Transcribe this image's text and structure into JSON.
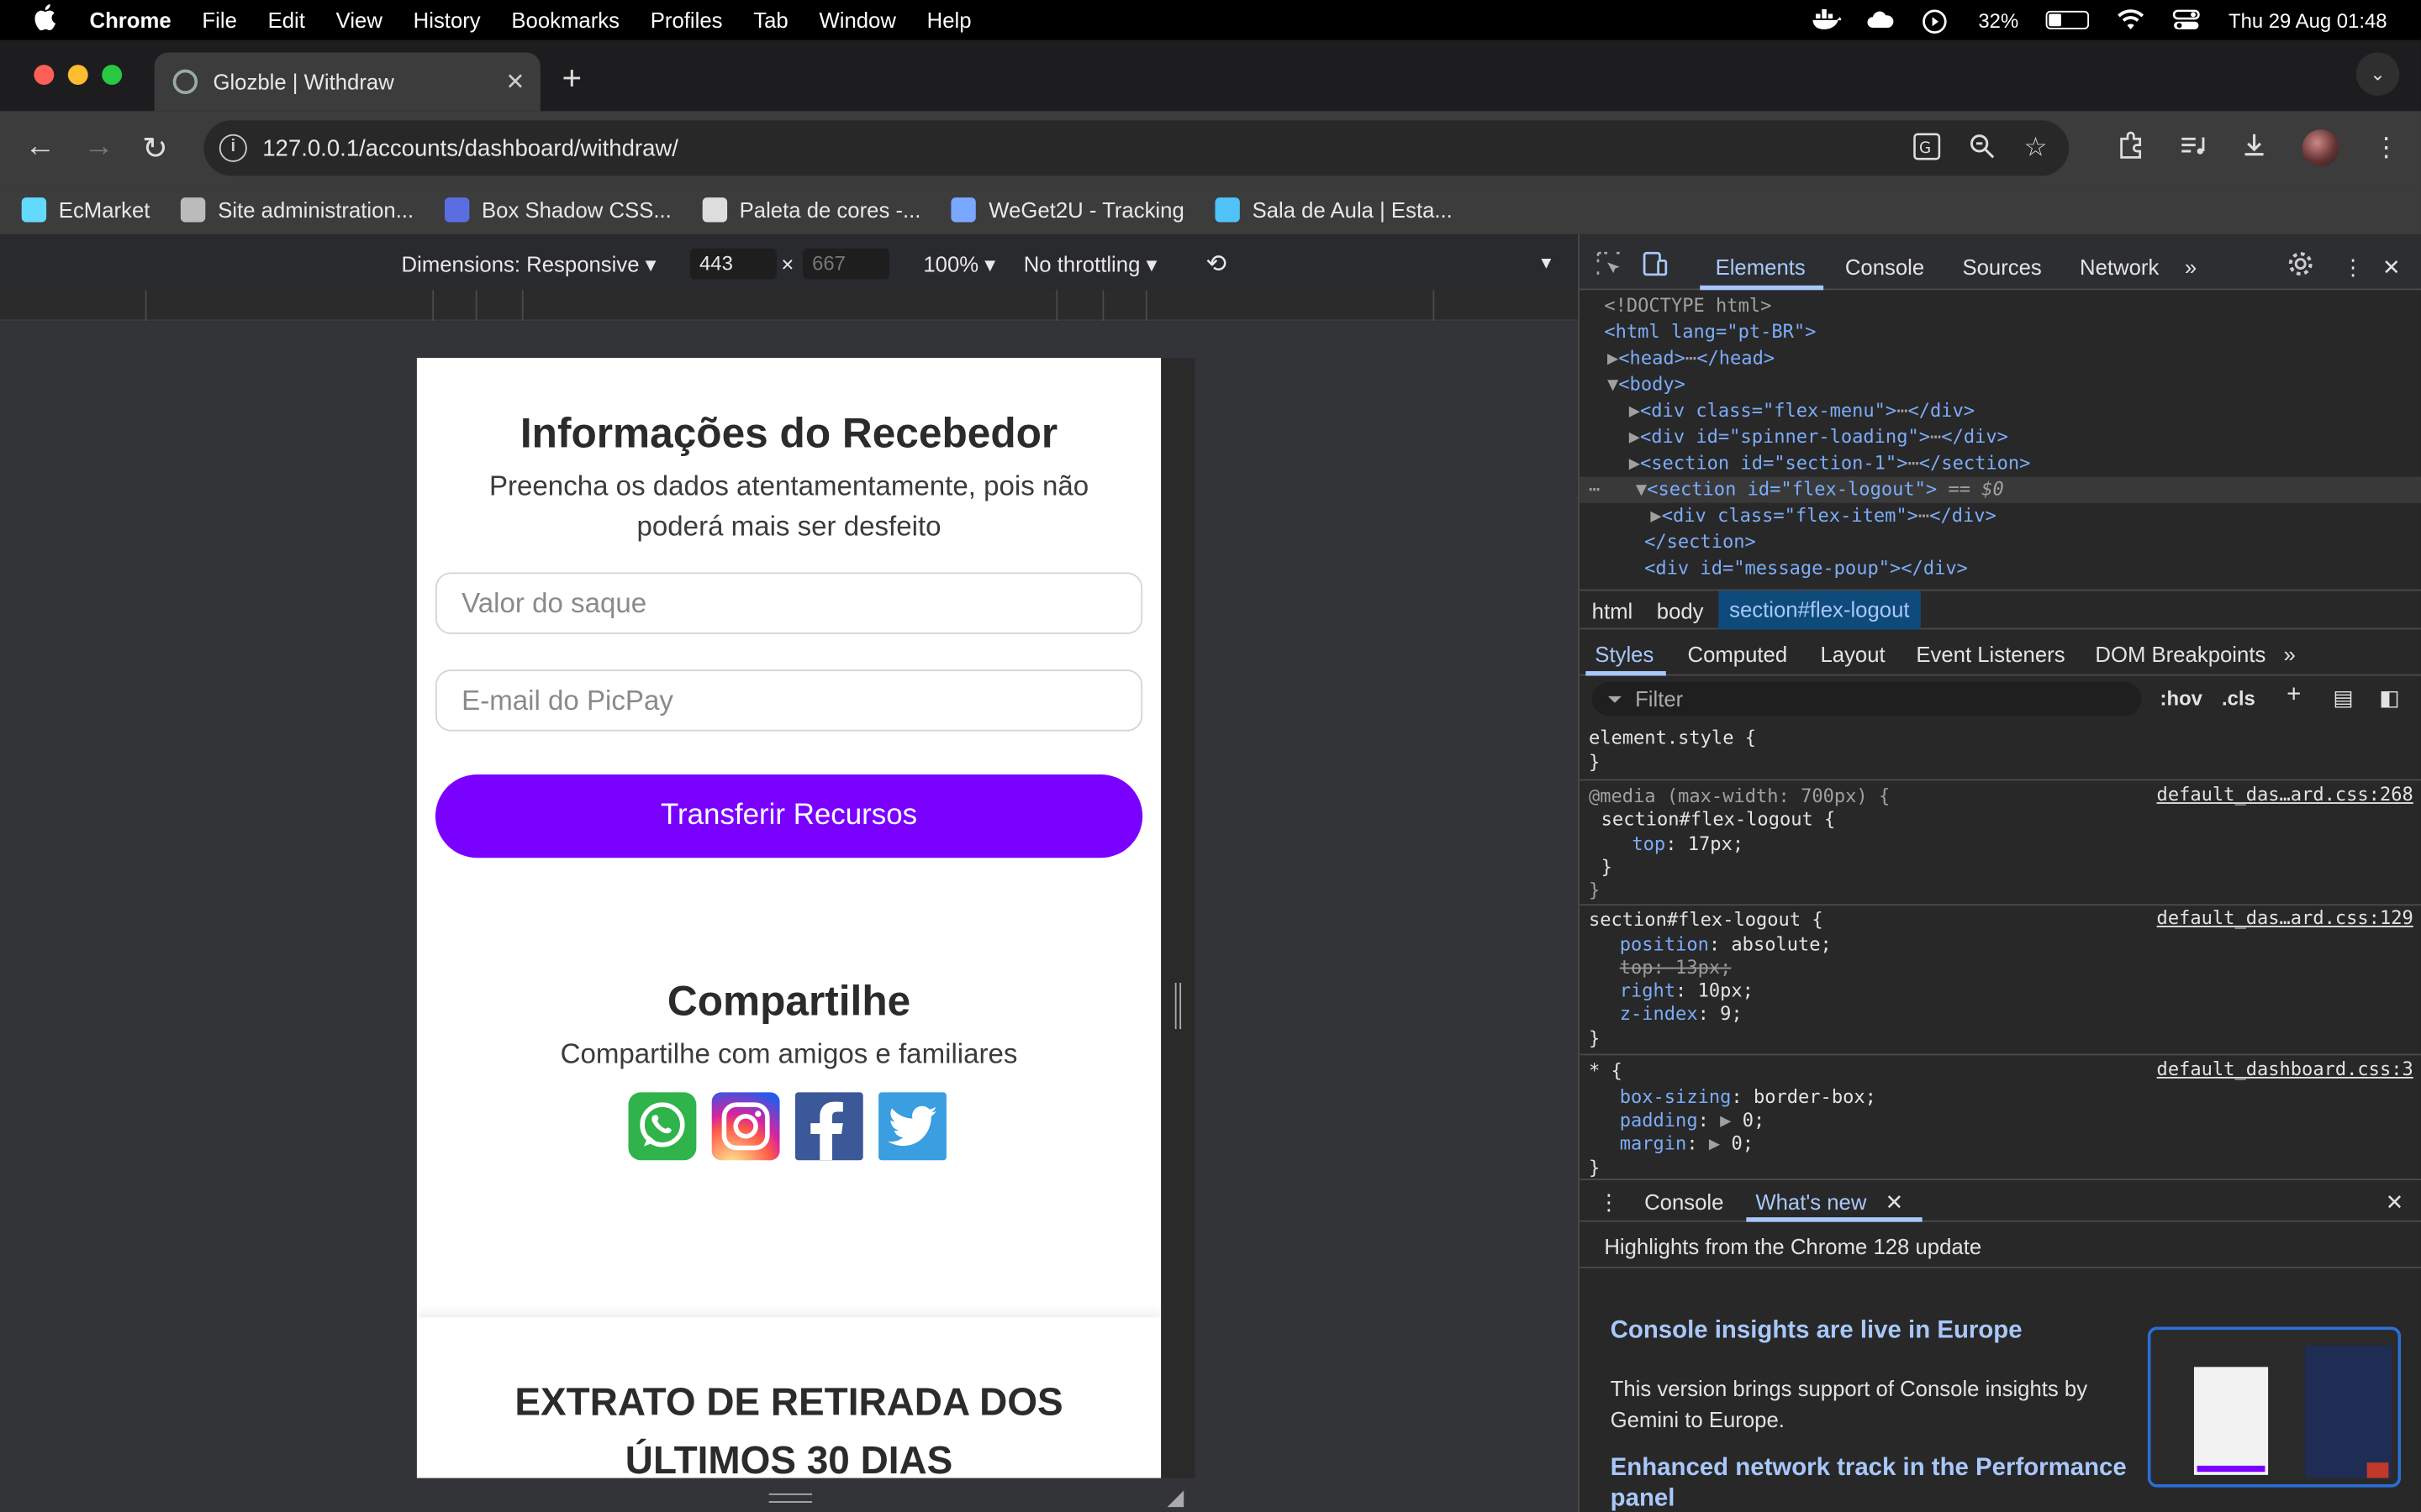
{
  "menubar": {
    "app": "Chrome",
    "items": [
      "File",
      "Edit",
      "View",
      "History",
      "Bookmarks",
      "Profiles",
      "Tab",
      "Window",
      "Help"
    ],
    "battery": "32%",
    "battery_level": 0.32,
    "datetime": "Thu 29 Aug  01:48"
  },
  "tab": {
    "title": "Glozble | Withdraw"
  },
  "toolbar": {
    "url": "127.0.0.1/accounts/dashboard/withdraw/"
  },
  "bookmarks": [
    {
      "label": "EcMarket",
      "color": "#61dafb"
    },
    {
      "label": "Site administration...",
      "color": "#bbbbbb"
    },
    {
      "label": "Box Shadow CSS...",
      "color": "#5b6ee1"
    },
    {
      "label": "Paleta de cores -...",
      "color": "#dddddd"
    },
    {
      "label": "WeGet2U - Tracking",
      "color": "#7aa7ff"
    },
    {
      "label": "Sala de Aula | Esta...",
      "color": "#4fc3f7"
    }
  ],
  "device_toolbar": {
    "dimensions": "Dimensions: Responsive",
    "width": "443",
    "height": "667",
    "zoom": "100%",
    "throttling": "No throttling"
  },
  "page": {
    "receiver_title": "Informações do Recebedor",
    "receiver_subtitle": "Preencha os dados atentamentamente, pois não poderá mais ser desfeito",
    "amount_placeholder": "Valor do saque",
    "email_placeholder": "E-mail do PicPay",
    "transfer_button": "Transferir Recursos",
    "share_title": "Compartilhe",
    "share_subtitle": "Compartilhe com amigos e familiares",
    "extrato_title": "EXTRATO DE RETIRADA DOS ÚLTIMOS 30 DIAS",
    "accent_color": "#7a00ff"
  },
  "devtools": {
    "tabs": [
      "Elements",
      "Console",
      "Sources",
      "Network"
    ],
    "dom": {
      "doctype": "<!DOCTYPE html>",
      "html_open": "<html lang=\"pt-BR\">",
      "head": "<head>",
      "head_close": "</head>",
      "body": "<body>",
      "flex_menu": "<div class=\"flex-menu\">",
      "div_close": "</div>",
      "spinner": "<div id=\"spinner-loading\">",
      "section1": "<section id=\"section-1\">",
      "section_close": "</section>",
      "flex_logout": "<section id=\"flex-logout\">",
      "selected_marker": " == $0",
      "flex_item": "<div class=\"flex-item\">",
      "message_poup": "<div id=\"message-poup\"></div>"
    },
    "breadcrumbs": [
      "html",
      "body",
      "section#flex-logout"
    ],
    "style_tabs": [
      "Styles",
      "Computed",
      "Layout",
      "Event Listeners",
      "DOM Breakpoints"
    ],
    "filter_placeholder": "Filter",
    "hov": ":hov",
    "cls": ".cls",
    "rules": {
      "element_style": "element.style {",
      "close": "}",
      "media": "@media (max-width: 700px) {",
      "media_sel": "section#flex-logout {",
      "media_src": "default_das…ard.css:268",
      "media_prop": "top",
      "media_val": "17px;",
      "rule2_sel": "section#flex-logout {",
      "rule2_src": "default_das…ard.css:129",
      "position": "position",
      "position_val": "absolute;",
      "top_strike": "top: 13px;",
      "right": "right",
      "right_val": "10px;",
      "zindex": "z-index",
      "zindex_val": "9;",
      "rule3_sel": "* {",
      "rule3_src": "default_dashboard.css:3",
      "boxsizing": "box-sizing",
      "boxsizing_val": "border-box;",
      "padding": "padding",
      "padding_val": "0;",
      "margin": "margin",
      "margin_val": "0;"
    },
    "drawer": {
      "tab_console": "Console",
      "tab_whatsnew": "What's new",
      "highlights": "Highlights from the Chrome 128 update",
      "headline1": "Console insights are live in Europe",
      "para1": "This version brings support of Console insights by Gemini to Europe.",
      "headline2": "Enhanced network track in the Performance panel"
    }
  }
}
